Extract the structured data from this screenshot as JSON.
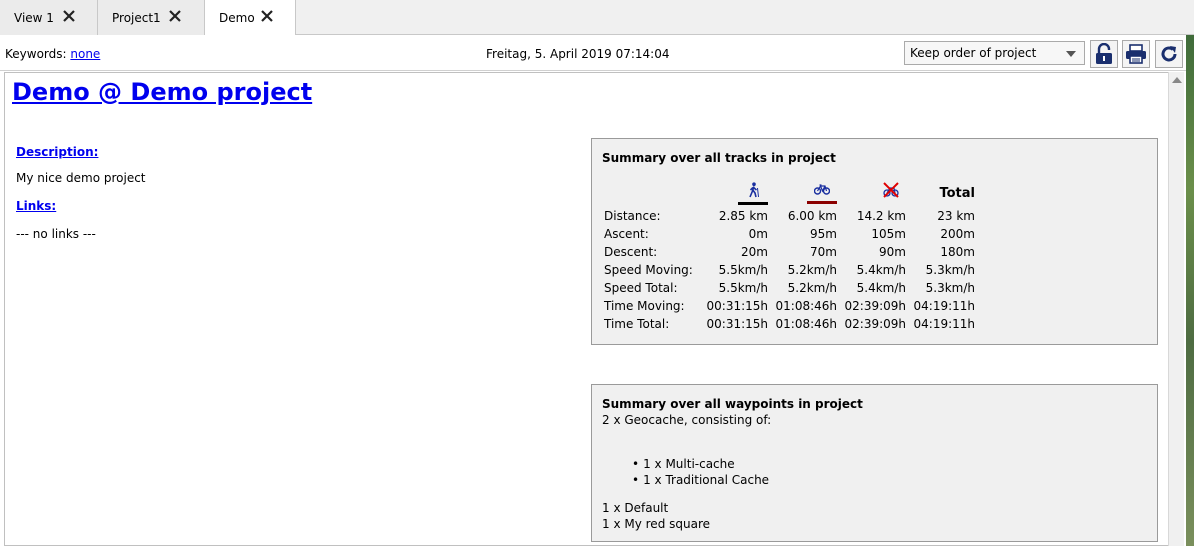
{
  "tabs": [
    {
      "label": "View 1"
    },
    {
      "label": "Project1"
    },
    {
      "label": "Demo"
    }
  ],
  "toolbar": {
    "keywords_label": "Keywords:",
    "keywords_value": "none",
    "datetime": "Freitag, 5. April 2019 07:14:04",
    "sort_value": "Keep order of project"
  },
  "page": {
    "title": "Demo @ Demo project",
    "description_heading": "Description:",
    "description_text": "My nice demo project",
    "links_heading": "Links:",
    "links_text": "--- no links ---"
  },
  "tracks_summary": {
    "title": "Summary over all tracks in project",
    "total_header": "Total",
    "rows": [
      {
        "label": "Distance:",
        "values": [
          "2.85 km",
          "6.00 km",
          "14.2 km",
          "23 km"
        ]
      },
      {
        "label": "Ascent:",
        "values": [
          "0m",
          "95m",
          "105m",
          "200m"
        ]
      },
      {
        "label": "Descent:",
        "values": [
          "20m",
          "70m",
          "90m",
          "180m"
        ]
      },
      {
        "label": "Speed Moving:",
        "values": [
          "5.5km/h",
          "5.2km/h",
          "5.4km/h",
          "5.3km/h"
        ]
      },
      {
        "label": "Speed Total:",
        "values": [
          "5.5km/h",
          "5.2km/h",
          "5.4km/h",
          "5.3km/h"
        ]
      },
      {
        "label": "Time Moving:",
        "values": [
          "00:31:15h",
          "01:08:46h",
          "02:39:09h",
          "04:19:11h"
        ]
      },
      {
        "label": "Time Total:",
        "values": [
          "00:31:15h",
          "01:08:46h",
          "02:39:09h",
          "04:19:11h"
        ]
      }
    ],
    "columns": [
      {
        "icon": "hiking-icon",
        "color": "#000000"
      },
      {
        "icon": "bicycle-icon",
        "color": "#8b0000"
      },
      {
        "icon": "no-cycling-icon",
        "color": null
      }
    ]
  },
  "waypoints_summary": {
    "title": "Summary over all waypoints in project",
    "geocache_line": "2 x Geocache, consisting of:",
    "geocache_items": [
      "1 x Multi-cache",
      "1 x Traditional Cache"
    ],
    "other_lines": [
      "1 x Default",
      "1 x My red square"
    ]
  }
}
